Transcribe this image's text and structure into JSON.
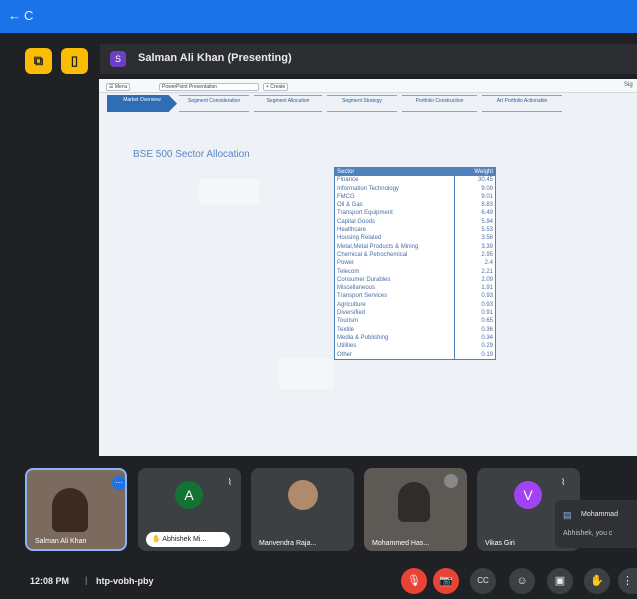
{
  "meeting": {
    "presenter_initial": "S",
    "presenter_label": "Salman Ali Khan (Presenting)",
    "time": "12:08 PM",
    "separator": "|",
    "meeting_code": "htp-vobh-pby"
  },
  "shared_screen": {
    "toolbar": {
      "menu_label": "☰ Menu",
      "tab_label": "PowerPoint Presentation",
      "new_tab": "+ Create",
      "right_text": "Sig"
    },
    "flow_steps": [
      "Market Overview",
      "Segment Consideration",
      "Segment Allocation",
      "Segment Strategy",
      "Portfolio Construction",
      "Art Portfolio Actionable"
    ],
    "slide_title": "BSE 500 Sector Allocation",
    "table_headers": [
      "Sector",
      "Weight"
    ],
    "table_rows": [
      [
        "Finance",
        "30.45"
      ],
      [
        "Information Technology",
        "9.09"
      ],
      [
        "FMCG",
        "9.01"
      ],
      [
        "Oil & Gas",
        "8.83"
      ],
      [
        "Transport Equipment",
        "6.49"
      ],
      [
        "Capital Goods",
        "5.94"
      ],
      [
        "Healthcare",
        "5.53"
      ],
      [
        "Housing Related",
        "3.58"
      ],
      [
        "Metal,Metal Products & Mining",
        "3.39"
      ],
      [
        "Chemical & Petrochemical",
        "2.95"
      ],
      [
        "Power",
        "2.4"
      ],
      [
        "Telecom",
        "2.21"
      ],
      [
        "Consumer Durables",
        "2.09"
      ],
      [
        "Miscellaneous",
        "1.91"
      ],
      [
        "Transport Services",
        "0.93"
      ],
      [
        "Agriculture",
        "0.93"
      ],
      [
        "Diversified",
        "0.91"
      ],
      [
        "Tourism",
        "0.65"
      ],
      [
        "Textile",
        "0.36"
      ],
      [
        "Media & Publishing",
        "0.34"
      ],
      [
        "Utilities",
        "0.29"
      ],
      [
        "Other",
        "0.19"
      ]
    ]
  },
  "participants": [
    {
      "name": "Salman Ali Khan",
      "type": "video",
      "color": "#6b5b53"
    },
    {
      "name": "Abhishek Mi...",
      "type": "avatar",
      "initial": "A",
      "color": "#137333"
    },
    {
      "name": "Manvendra Raja...",
      "type": "photo",
      "color": "#8a6a52"
    },
    {
      "name": "Mohammed Has...",
      "type": "video",
      "color": "#4e4a47"
    },
    {
      "name": "Vikas Giri",
      "type": "avatar",
      "initial": "V",
      "color": "#a142f4"
    }
  ],
  "chat_popup": {
    "sender": "Mohammad",
    "message": "Abhishek, you c"
  },
  "controls": {
    "mic_off": "🎙",
    "cam_off": "📷",
    "captions": "CC",
    "emoji": "☺",
    "present": "▣",
    "raise_hand": "✋",
    "more": "⋮"
  },
  "browser": {
    "back": "←",
    "reload": "C"
  },
  "colors": {
    "accent": "#1a73e8",
    "danger": "#ea4335",
    "warning": "#fbbc04",
    "table_header": "#4f81bd"
  }
}
